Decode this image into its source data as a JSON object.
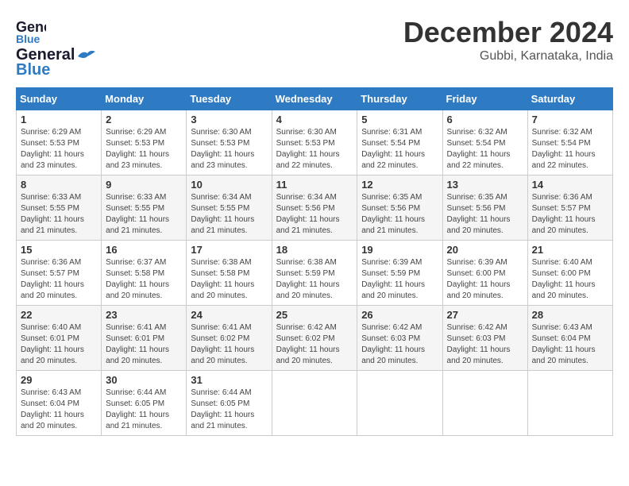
{
  "header": {
    "logo_line1": "General",
    "logo_line2": "Blue",
    "month": "December 2024",
    "location": "Gubbi, Karnataka, India"
  },
  "weekdays": [
    "Sunday",
    "Monday",
    "Tuesday",
    "Wednesday",
    "Thursday",
    "Friday",
    "Saturday"
  ],
  "weeks": [
    [
      {
        "day": "1",
        "sunrise": "6:29 AM",
        "sunset": "5:53 PM",
        "daylight": "11 hours and 23 minutes."
      },
      {
        "day": "2",
        "sunrise": "6:29 AM",
        "sunset": "5:53 PM",
        "daylight": "11 hours and 23 minutes."
      },
      {
        "day": "3",
        "sunrise": "6:30 AM",
        "sunset": "5:53 PM",
        "daylight": "11 hours and 23 minutes."
      },
      {
        "day": "4",
        "sunrise": "6:30 AM",
        "sunset": "5:53 PM",
        "daylight": "11 hours and 22 minutes."
      },
      {
        "day": "5",
        "sunrise": "6:31 AM",
        "sunset": "5:54 PM",
        "daylight": "11 hours and 22 minutes."
      },
      {
        "day": "6",
        "sunrise": "6:32 AM",
        "sunset": "5:54 PM",
        "daylight": "11 hours and 22 minutes."
      },
      {
        "day": "7",
        "sunrise": "6:32 AM",
        "sunset": "5:54 PM",
        "daylight": "11 hours and 22 minutes."
      }
    ],
    [
      {
        "day": "8",
        "sunrise": "6:33 AM",
        "sunset": "5:55 PM",
        "daylight": "11 hours and 21 minutes."
      },
      {
        "day": "9",
        "sunrise": "6:33 AM",
        "sunset": "5:55 PM",
        "daylight": "11 hours and 21 minutes."
      },
      {
        "day": "10",
        "sunrise": "6:34 AM",
        "sunset": "5:55 PM",
        "daylight": "11 hours and 21 minutes."
      },
      {
        "day": "11",
        "sunrise": "6:34 AM",
        "sunset": "5:56 PM",
        "daylight": "11 hours and 21 minutes."
      },
      {
        "day": "12",
        "sunrise": "6:35 AM",
        "sunset": "5:56 PM",
        "daylight": "11 hours and 21 minutes."
      },
      {
        "day": "13",
        "sunrise": "6:35 AM",
        "sunset": "5:56 PM",
        "daylight": "11 hours and 20 minutes."
      },
      {
        "day": "14",
        "sunrise": "6:36 AM",
        "sunset": "5:57 PM",
        "daylight": "11 hours and 20 minutes."
      }
    ],
    [
      {
        "day": "15",
        "sunrise": "6:36 AM",
        "sunset": "5:57 PM",
        "daylight": "11 hours and 20 minutes."
      },
      {
        "day": "16",
        "sunrise": "6:37 AM",
        "sunset": "5:58 PM",
        "daylight": "11 hours and 20 minutes."
      },
      {
        "day": "17",
        "sunrise": "6:38 AM",
        "sunset": "5:58 PM",
        "daylight": "11 hours and 20 minutes."
      },
      {
        "day": "18",
        "sunrise": "6:38 AM",
        "sunset": "5:59 PM",
        "daylight": "11 hours and 20 minutes."
      },
      {
        "day": "19",
        "sunrise": "6:39 AM",
        "sunset": "5:59 PM",
        "daylight": "11 hours and 20 minutes."
      },
      {
        "day": "20",
        "sunrise": "6:39 AM",
        "sunset": "6:00 PM",
        "daylight": "11 hours and 20 minutes."
      },
      {
        "day": "21",
        "sunrise": "6:40 AM",
        "sunset": "6:00 PM",
        "daylight": "11 hours and 20 minutes."
      }
    ],
    [
      {
        "day": "22",
        "sunrise": "6:40 AM",
        "sunset": "6:01 PM",
        "daylight": "11 hours and 20 minutes."
      },
      {
        "day": "23",
        "sunrise": "6:41 AM",
        "sunset": "6:01 PM",
        "daylight": "11 hours and 20 minutes."
      },
      {
        "day": "24",
        "sunrise": "6:41 AM",
        "sunset": "6:02 PM",
        "daylight": "11 hours and 20 minutes."
      },
      {
        "day": "25",
        "sunrise": "6:42 AM",
        "sunset": "6:02 PM",
        "daylight": "11 hours and 20 minutes."
      },
      {
        "day": "26",
        "sunrise": "6:42 AM",
        "sunset": "6:03 PM",
        "daylight": "11 hours and 20 minutes."
      },
      {
        "day": "27",
        "sunrise": "6:42 AM",
        "sunset": "6:03 PM",
        "daylight": "11 hours and 20 minutes."
      },
      {
        "day": "28",
        "sunrise": "6:43 AM",
        "sunset": "6:04 PM",
        "daylight": "11 hours and 20 minutes."
      }
    ],
    [
      {
        "day": "29",
        "sunrise": "6:43 AM",
        "sunset": "6:04 PM",
        "daylight": "11 hours and 20 minutes."
      },
      {
        "day": "30",
        "sunrise": "6:44 AM",
        "sunset": "6:05 PM",
        "daylight": "11 hours and 21 minutes."
      },
      {
        "day": "31",
        "sunrise": "6:44 AM",
        "sunset": "6:05 PM",
        "daylight": "11 hours and 21 minutes."
      },
      null,
      null,
      null,
      null
    ]
  ]
}
